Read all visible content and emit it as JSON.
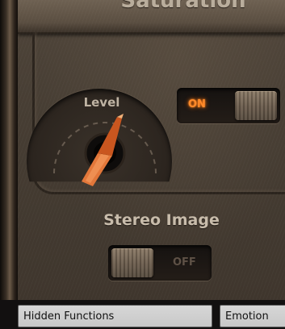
{
  "section": {
    "title": "Saturation"
  },
  "level": {
    "label": "Level",
    "value_fraction": 0.55,
    "accent_color": "#d9612b"
  },
  "saturation_switch": {
    "on_label": "ON",
    "state": "on",
    "on_color": "#ff8a2a"
  },
  "stereo_image": {
    "label": "Stereo Image",
    "off_label": "OFF",
    "state": "off"
  },
  "tabs": [
    {
      "label": "Hidden Functions"
    },
    {
      "label": "Emotion"
    }
  ]
}
